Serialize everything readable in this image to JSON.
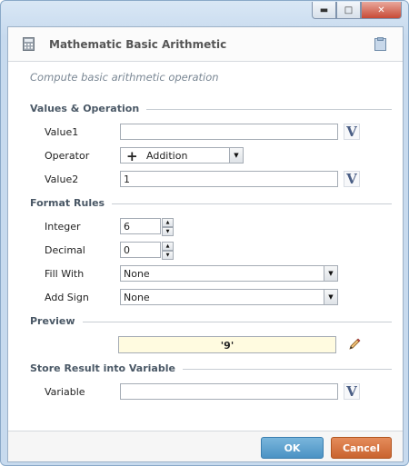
{
  "window": {
    "title": "Mathematic Basic Arithmetic",
    "description": "Compute basic arithmetic operation",
    "controls": {
      "minimize": "minimize-icon",
      "maximize": "maximize-icon",
      "close": "close-icon"
    }
  },
  "sections": {
    "values": "Values & Operation",
    "format": "Format Rules",
    "preview": "Preview",
    "store": "Store Result into Variable"
  },
  "fields": {
    "value1": {
      "label": "Value1",
      "value": ""
    },
    "operator": {
      "label": "Operator",
      "value": "Addition",
      "symbol": "+"
    },
    "value2": {
      "label": "Value2",
      "value": "1"
    },
    "integer": {
      "label": "Integer",
      "value": "6"
    },
    "decimal": {
      "label": "Decimal",
      "value": "0"
    },
    "fill_with": {
      "label": "Fill With",
      "value": "None"
    },
    "add_sign": {
      "label": "Add Sign",
      "value": "None"
    },
    "variable": {
      "label": "Variable",
      "value": ""
    }
  },
  "preview_value": "'9'",
  "variable_button_glyph": "V",
  "buttons": {
    "ok": "OK",
    "cancel": "Cancel"
  },
  "colors": {
    "ok": "#5a9fcf",
    "cancel": "#d46e39",
    "preview_bg": "#fffbe0"
  }
}
